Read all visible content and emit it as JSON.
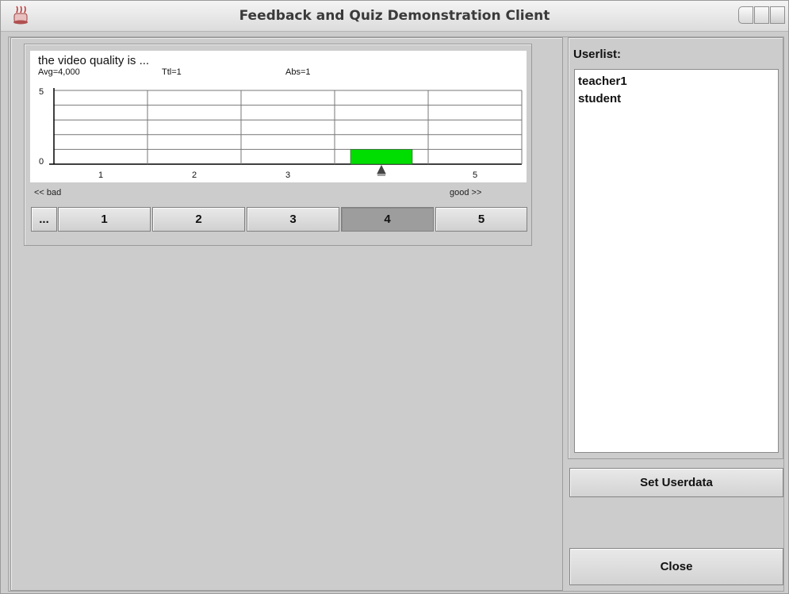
{
  "window": {
    "title": "Feedback and Quiz Demonstration Client"
  },
  "quiz": {
    "question": "the video quality is ...",
    "stats": {
      "avg": "Avg=4,000",
      "total": "Ttl=1",
      "abs": "Abs=1"
    },
    "hint_low": "<< bad",
    "hint_high": "good >>",
    "more_label": "...",
    "vote_buttons": [
      "1",
      "2",
      "3",
      "4",
      "5"
    ],
    "selected_vote": "4"
  },
  "chart_data": {
    "type": "bar",
    "categories": [
      "1",
      "2",
      "3",
      "4",
      "5"
    ],
    "values": [
      0,
      0,
      0,
      1,
      0
    ],
    "ylim": [
      0,
      5
    ],
    "y_ticks": [
      "0",
      "5"
    ],
    "grid": true,
    "bar_color": "#00dd00",
    "marker_category": "4"
  },
  "users": {
    "label": "Userlist:",
    "items": [
      "teacher1",
      "student"
    ]
  },
  "buttons": {
    "set_userdata": "Set Userdata",
    "close": "Close"
  },
  "colors": {
    "selected_button": "#9d9d9d",
    "window_bg": "#cccccc"
  }
}
